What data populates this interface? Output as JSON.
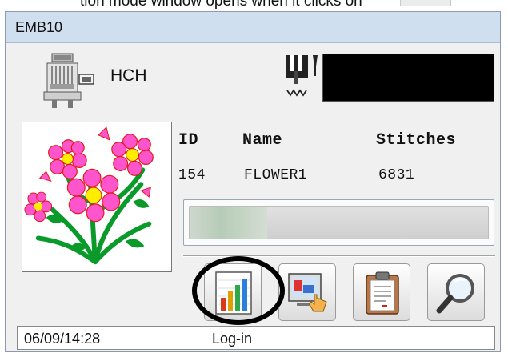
{
  "caption": {
    "text": "tion mode window opens when it clicks on"
  },
  "window": {
    "title": "EMB10"
  },
  "machine": {
    "icon": "embroidery-machine-icon",
    "label": "HCH"
  },
  "needle": {
    "icon": "needle-bar-icon"
  },
  "design": {
    "thumbnail": "flower-design-thumbnail",
    "headers": {
      "id": "ID",
      "name": "Name",
      "stitches": "Stitches"
    },
    "values": {
      "id": "154",
      "name": "FLOWER1",
      "stitches": "6831"
    }
  },
  "progress": {
    "value_fraction": 0.26
  },
  "toolbar": [
    {
      "icon": "bar-chart-icon",
      "highlighted": true
    },
    {
      "icon": "monitor-hand-icon"
    },
    {
      "icon": "clipboard-icon"
    },
    {
      "icon": "magnifier-icon"
    }
  ],
  "status": {
    "time": "06/09/14:28",
    "text": "Log-in"
  },
  "colors": {
    "titlebar": "#cfdff0",
    "window_bg": "#f0f0f0",
    "display": "#000000"
  }
}
